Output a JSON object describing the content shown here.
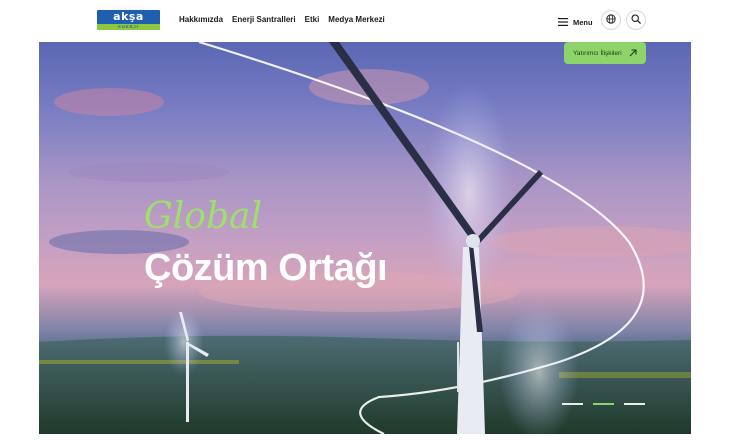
{
  "brand": {
    "name": "akşa",
    "tagline": "ENERJİ"
  },
  "nav": {
    "items": [
      {
        "label": "Hakkımızda"
      },
      {
        "label": "Enerji Santralleri"
      },
      {
        "label": "Etki"
      },
      {
        "label": "Medya Merkezi"
      }
    ]
  },
  "header": {
    "menu_label": "Menu",
    "menu_icon": "hamburger-icon",
    "language_icon": "globe-icon",
    "search_icon": "search-icon"
  },
  "hero": {
    "investor_button": {
      "label": "Yatırımcı İlişkileri",
      "icon": "arrow-up-right-icon"
    },
    "headline_line1": "Global",
    "headline_line2": "Çözüm Ortağı",
    "slides": {
      "count": 3,
      "active": 2
    }
  },
  "colors": {
    "accent_green": "#8fd46a",
    "headline_green": "#9ee06a",
    "brand_blue": "#1e5fb0",
    "text_dark": "#1a1a1a"
  }
}
